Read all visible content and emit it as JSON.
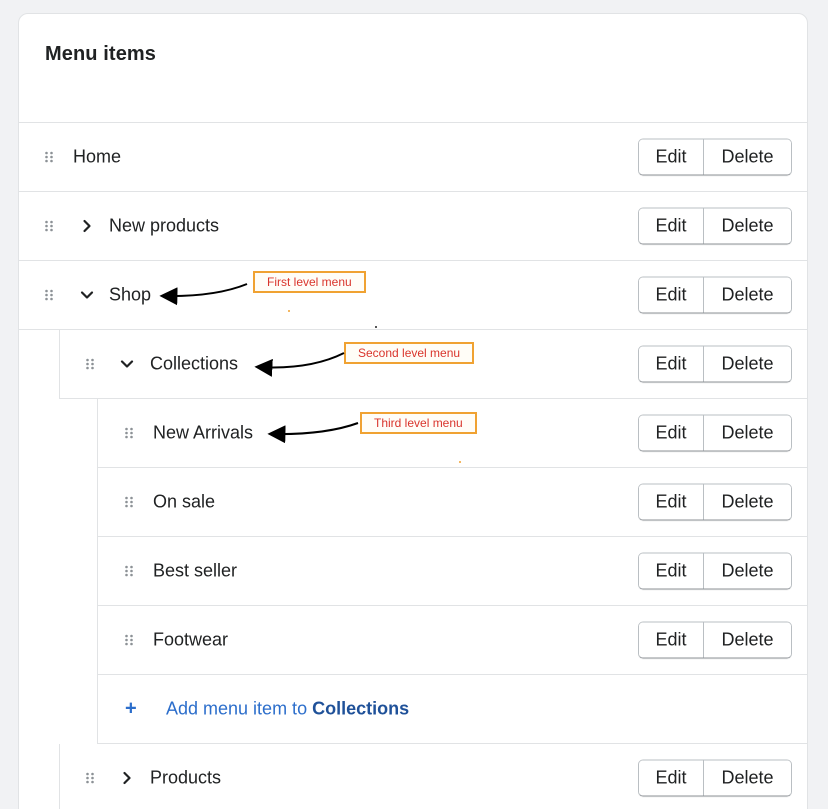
{
  "card": {
    "title": "Menu items"
  },
  "buttons": {
    "edit": "Edit",
    "delete": "Delete"
  },
  "items": [
    {
      "label": "Home",
      "level": 1,
      "toggle": "none"
    },
    {
      "label": "New products",
      "level": 1,
      "toggle": "collapsed"
    },
    {
      "label": "Shop",
      "level": 1,
      "toggle": "expanded"
    },
    {
      "label": "Collections",
      "level": 2,
      "toggle": "expanded"
    },
    {
      "label": "New Arrivals",
      "level": 3,
      "toggle": "none"
    },
    {
      "label": "On sale",
      "level": 3,
      "toggle": "none"
    },
    {
      "label": "Best seller",
      "level": 3,
      "toggle": "none"
    },
    {
      "label": "Footwear",
      "level": 3,
      "toggle": "none"
    },
    {
      "label": "Products",
      "level": 2,
      "toggle": "collapsed"
    }
  ],
  "add_item": {
    "plus": "+",
    "text": "Add menu item to ",
    "target": "Collections"
  },
  "annotations": {
    "first_level": "First level menu",
    "second_level": "Second level menu",
    "third_level": "Third level menu"
  },
  "colors": {
    "accent": "#2c6ecb",
    "annotation_border": "#f0a232",
    "annotation_text": "#d9352c",
    "background": "#f1f2f4"
  }
}
